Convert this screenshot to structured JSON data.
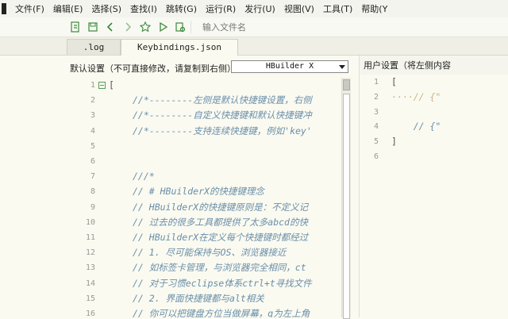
{
  "menu": {
    "items": [
      "文件(F)",
      "编辑(E)",
      "选择(S)",
      "查找(I)",
      "跳转(G)",
      "运行(R)",
      "发行(U)",
      "视图(V)",
      "工具(T)",
      "帮助(Y"
    ]
  },
  "toolbar": {
    "icons": [
      "new-file-icon",
      "save-icon",
      "back-arrow-icon",
      "forward-arrow-icon",
      "star-icon",
      "play-icon",
      "preview-icon"
    ],
    "file_input_placeholder": "输入文件名"
  },
  "tabs": [
    {
      "label": ".log",
      "active": false
    },
    {
      "label": "Keybindings.json",
      "active": true
    }
  ],
  "left_pane": {
    "label": "默认设置（不可直接修改，请复制到右侧）",
    "select_value": "HBuilder X",
    "lines": [
      {
        "n": "1",
        "text": "[",
        "type": "bracket",
        "indent": 0
      },
      {
        "n": "2",
        "text": "//*--------左侧是默认快捷键设置，右侧",
        "type": "comment",
        "indent": 4
      },
      {
        "n": "3",
        "text": "//*--------自定义快捷键和默认快捷键冲",
        "type": "comment",
        "indent": 4
      },
      {
        "n": "4",
        "text": "//*--------支持连续快捷键，例如'key'",
        "type": "comment",
        "indent": 4
      },
      {
        "n": "5",
        "text": "",
        "type": "blank",
        "indent": 0
      },
      {
        "n": "6",
        "text": "",
        "type": "blank",
        "indent": 0
      },
      {
        "n": "7",
        "text": "///*",
        "type": "comment",
        "indent": 4
      },
      {
        "n": "8",
        "text": "// # HBuilderX的快捷键理念",
        "type": "comment",
        "indent": 4
      },
      {
        "n": "9",
        "text": "// HBuilderX的快捷键原则是：不定义记",
        "type": "comment",
        "indent": 4
      },
      {
        "n": "10",
        "text": "// 过去的很多工具都提供了太多abcd的快",
        "type": "comment",
        "indent": 4
      },
      {
        "n": "11",
        "text": "// HBuilderX在定义每个快捷键时都经过",
        "type": "comment",
        "indent": 4
      },
      {
        "n": "12",
        "text": "// 1. 尽可能保持与OS、浏览器接近",
        "type": "comment",
        "indent": 4
      },
      {
        "n": "13",
        "text": "// 如标签卡管理，与浏览器完全相同，ct",
        "type": "comment",
        "indent": 4
      },
      {
        "n": "14",
        "text": "// 对于习惯eclipse体系ctrl+t寻找文件",
        "type": "comment",
        "indent": 4
      },
      {
        "n": "15",
        "text": "// 2. 界面快捷键都与alt相关",
        "type": "comment",
        "indent": 4
      },
      {
        "n": "16",
        "text": "// 你可以把键盘方位当做屏幕，q为左上角",
        "type": "comment",
        "indent": 4
      }
    ]
  },
  "right_pane": {
    "label": "用户设置（将左侧内容",
    "lines": [
      {
        "n": "1",
        "text": "[",
        "type": "bracket"
      },
      {
        "n": "2",
        "text": "····// {\"",
        "type": "comment"
      },
      {
        "n": "3",
        "text": "",
        "type": "blank"
      },
      {
        "n": "4",
        "text": "    // {\"",
        "type": "comment"
      },
      {
        "n": "5",
        "text": "]",
        "type": "bracket"
      },
      {
        "n": "6",
        "text": "",
        "type": "blank"
      }
    ]
  },
  "colors": {
    "comment": "#6a8eaa",
    "background": "#fafaf0",
    "current_line": "#ebe8d2",
    "fold_marker": "#5a9a5a"
  }
}
